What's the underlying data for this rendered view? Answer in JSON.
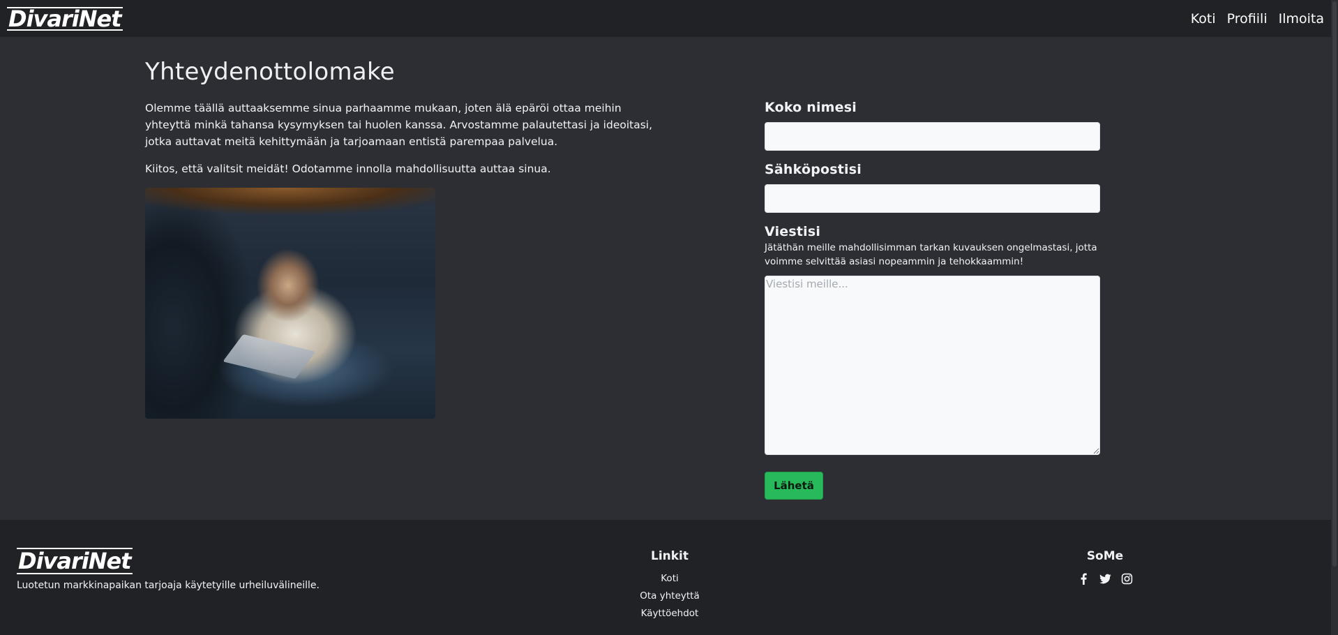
{
  "navbar": {
    "logo": "DivariNet",
    "links": [
      {
        "label": "Koti"
      },
      {
        "label": "Profiili"
      },
      {
        "label": "Ilmoita"
      }
    ]
  },
  "main": {
    "title": "Yhteydenottolomake",
    "intro": "Olemme täällä auttaaksemme sinua parhaamme mukaan, joten älä epäröi ottaa meihin yhteyttä minkä tahansa kysymyksen tai huolen kanssa. Arvostamme palautettasi ja ideoitasi, jotka auttavat meitä kehittymään ja tarjoamaan entistä parempaa palvelua.",
    "thanks": "Kiitos, että valitsit meidät! Odotamme innolla mahdollisuutta auttaa sinua."
  },
  "form": {
    "name_label": "Koko nimesi",
    "name_value": "",
    "email_label": "Sähköpostisi",
    "email_value": "",
    "message_label": "Viestisi",
    "message_help": "Jätäthän meille mahdollisimman tarkan kuvauksen ongelmastasi, jotta voimme selvittää asiasi nopeammin ja tehokkaammin!",
    "message_placeholder": "Viestisi meille...",
    "submit_label": "Lähetä"
  },
  "footer": {
    "logo": "DivariNet",
    "tagline": "Luotetun markkinapaikan tarjoaja käytetyille urheiluvälineille.",
    "links_heading": "Linkit",
    "links": [
      {
        "label": "Koti"
      },
      {
        "label": "Ota yhteyttä"
      },
      {
        "label": "Käyttöehdot"
      }
    ],
    "some_heading": "SoMe",
    "social_icons": [
      "facebook-icon",
      "twitter-icon",
      "instagram-icon"
    ]
  },
  "colors": {
    "background": "#2c2e33",
    "navbar": "#212226",
    "accent_button": "#28b95a"
  }
}
